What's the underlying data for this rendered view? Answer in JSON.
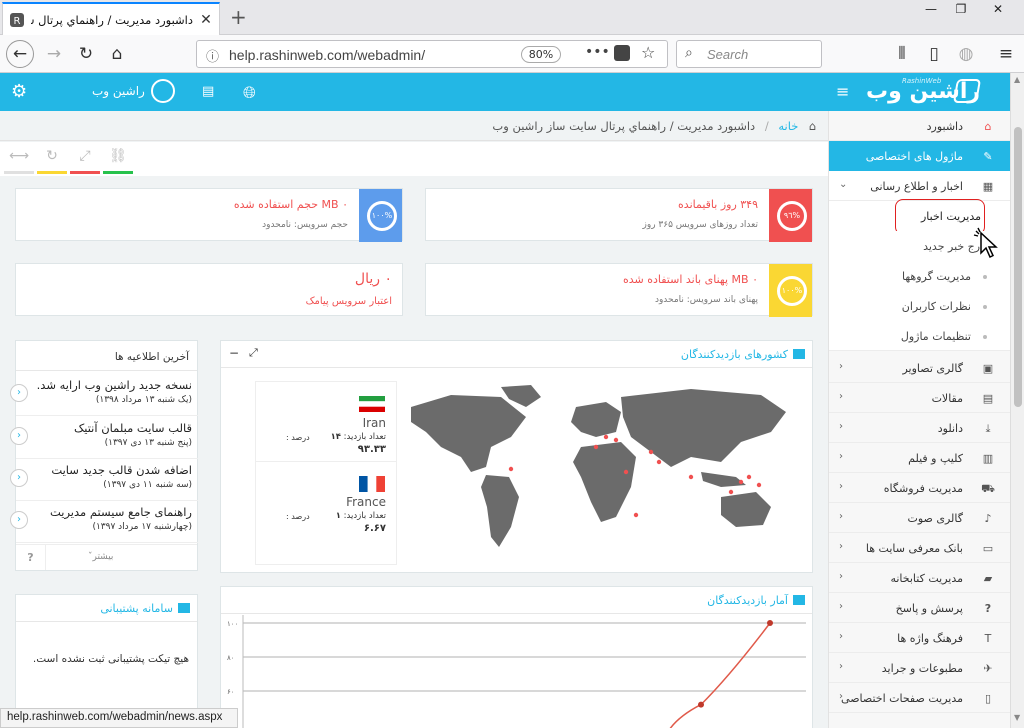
{
  "browser": {
    "tab_title": "داشبورد مديريت / راهنماي پرتال سا",
    "url": "help.rashinweb.com/webadmin/",
    "zoom": "80%",
    "search_placeholder": "Search",
    "status_url": "help.rashinweb.com/webadmin/news.aspx"
  },
  "header": {
    "username": "راشین وب",
    "logo_text": "راشین وب",
    "logo_sub": "RashinWeb"
  },
  "breadcrumb": {
    "home": "خانه",
    "path": "داشبورد مديريت / راهنماي پرتال سايت ساز راشين وب"
  },
  "stats": [
    {
      "ring": "٩٦%",
      "title": "۳۴۹ روز باقیمانده",
      "sub": "تعداد روزهای سرویس ۳۶۵ روز",
      "color": "#f05050"
    },
    {
      "ring": "۱۰۰%",
      "title": "۰ MB حجم استفاده شده",
      "sub": "حجم سرویس: نامحدود",
      "color": "#5d9cec"
    },
    {
      "ring": "۱۰۰%",
      "title": "۰ MB پهنای باند استفاده شده",
      "sub": "پهنای باند سرویس: نامحدود",
      "color": "#fad733"
    },
    {
      "title": "۰ ریال",
      "sub": "اعتبار سرویس پیامک"
    }
  ],
  "countries_panel": {
    "title": "کشورهای بازدیدکنندگان",
    "items": [
      {
        "name": "Iran",
        "visits_label": "تعداد بازدید:",
        "visits": "۱۴",
        "percent_label": "درصد :",
        "percent": "۹۳.۳۳"
      },
      {
        "name": "France",
        "visits_label": "تعداد بازدید:",
        "visits": "۱",
        "percent_label": "درصد :",
        "percent": "۶.۶۷"
      }
    ]
  },
  "stats_panel": {
    "title": "آمار بازدیدکنندگان",
    "y_ticks": [
      "۱۰۰",
      "۸۰",
      "۶۰"
    ]
  },
  "chart_data": {
    "type": "line",
    "title": "آمار بازدیدکنندگان",
    "xlabel": "",
    "ylabel": "",
    "y_ticks": [
      100,
      80,
      60
    ],
    "series": [
      {
        "values": [
          40,
          52,
          100
        ]
      }
    ]
  },
  "news_panel": {
    "title": "آخرین اطلاعیه ها",
    "items": [
      {
        "title": "نسخه جدید راشین وب ارایه شد.",
        "date": "(یک شنبه ۱۳ مرداد ۱۳۹۸)"
      },
      {
        "title": "قالب سایت مبلمان آنتیک",
        "date": "(پنج شنبه ۱۳ دی ۱۳۹۷)"
      },
      {
        "title": "اضافه شدن قالب جدید سایت",
        "date": "(سه شنبه ۱۱ دی ۱۳۹۷)"
      },
      {
        "title": "راهنمای جامع سیستم مدیریت",
        "date": "(چهارشنبه ۱۷ مرداد ۱۳۹۷)"
      }
    ],
    "more": "بیشتر",
    "help": "?"
  },
  "support_panel": {
    "title": "سامانه پشتیبانی",
    "empty": "هیچ تیکت پشتیبانی ثبت نشده است."
  },
  "sidebar": {
    "items": [
      {
        "label": "داشبورد",
        "icon": "home-icon"
      },
      {
        "label": "ماژول های اختصاصی",
        "icon": "pencil-icon"
      },
      {
        "label": "اخبار و اطلاع رسانی",
        "icon": "newspaper-icon"
      }
    ],
    "sub_items": [
      "مدیریت اخبار",
      "درج خبر جدید",
      "مدیریت گروهها",
      "نظرات کاربران",
      "تنظیمات ماژول"
    ],
    "more_items": [
      "گالری تصاویر",
      "مقالات",
      "دانلود",
      "کلیپ و فیلم",
      "مدیریت فروشگاه",
      "گالری صوت",
      "بانک معرفی سایت ها",
      "مدیریت کتابخانه",
      "پرسش و پاسخ",
      "فرهنگ واژه ها",
      "مطبوعات و جراید",
      "مدیریت صفحات اختصاصی"
    ]
  },
  "colors": {
    "accent": "#23b7e5",
    "danger": "#f05050",
    "blue": "#5d9cec",
    "yellow": "#fad733"
  }
}
